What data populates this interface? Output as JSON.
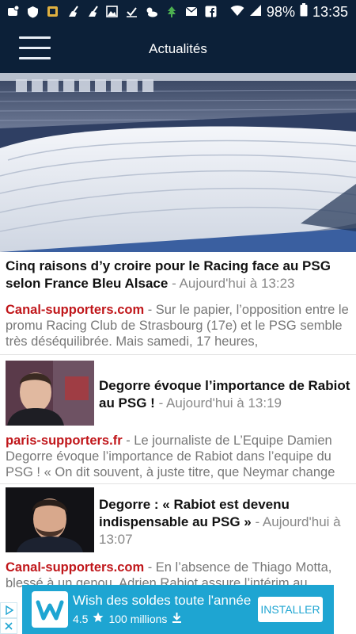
{
  "status_bar": {
    "battery": "98%",
    "time": "13:35",
    "icons": [
      "notification-icon",
      "shield-icon",
      "app-icon",
      "broom-icon",
      "broom-icon",
      "image-icon",
      "check-icon",
      "weather-icon",
      "tree-icon",
      "mail-icon",
      "facebook-icon",
      "wifi-icon",
      "signal-icon",
      "battery-icon"
    ]
  },
  "app_bar": {
    "title": "Actualités",
    "menu_icon": "hamburger-icon"
  },
  "articles": [
    {
      "title": "Cinq raisons d’y croire pour le Racing face au PSG selon France Bleu Alsace",
      "time": "- Aujourd'hui à 13:23",
      "source": "Canal-supporters.com",
      "excerpt": " - Sur le papier, l’opposition entre le promu Racing Club de Strasbourg (17e) et le PSG semble très déséquilibrée. Mais samedi, 17 heures,",
      "image": "stadium-photo"
    },
    {
      "title": "Degorre évoque l’importance de Rabiot au PSG !",
      "time": " - Aujourd'hui à 13:19",
      "source": "paris-supporters.fr",
      "excerpt": " - Le journaliste de L’Equipe Damien Degorre évoque l’importance de Rabiot dans l’equipe du PSG ! « On dit souvent, à juste titre, que Neymar change",
      "image": "journalist-photo"
    },
    {
      "title": "Degorre : « Rabiot est devenu indispensable au PSG »",
      "time": " - Aujourd'hui à 13:07",
      "source": "Canal-supporters.com",
      "excerpt": " - En l’absence de Thiago Motta, blessé à un genou, Adrien Rabiot assure l’intérim au",
      "image": "journalist-photo"
    }
  ],
  "ad": {
    "title": "Wish des soldes toute l'année",
    "rating": "4.5",
    "installs": "100 millions",
    "button": "INSTALLER",
    "colors": {
      "background": "#1ea5d2",
      "button_text": "#1ea5d2"
    }
  },
  "colors": {
    "bar": "#0c2038",
    "source": "#c0161a",
    "excerpt": "#777777"
  }
}
